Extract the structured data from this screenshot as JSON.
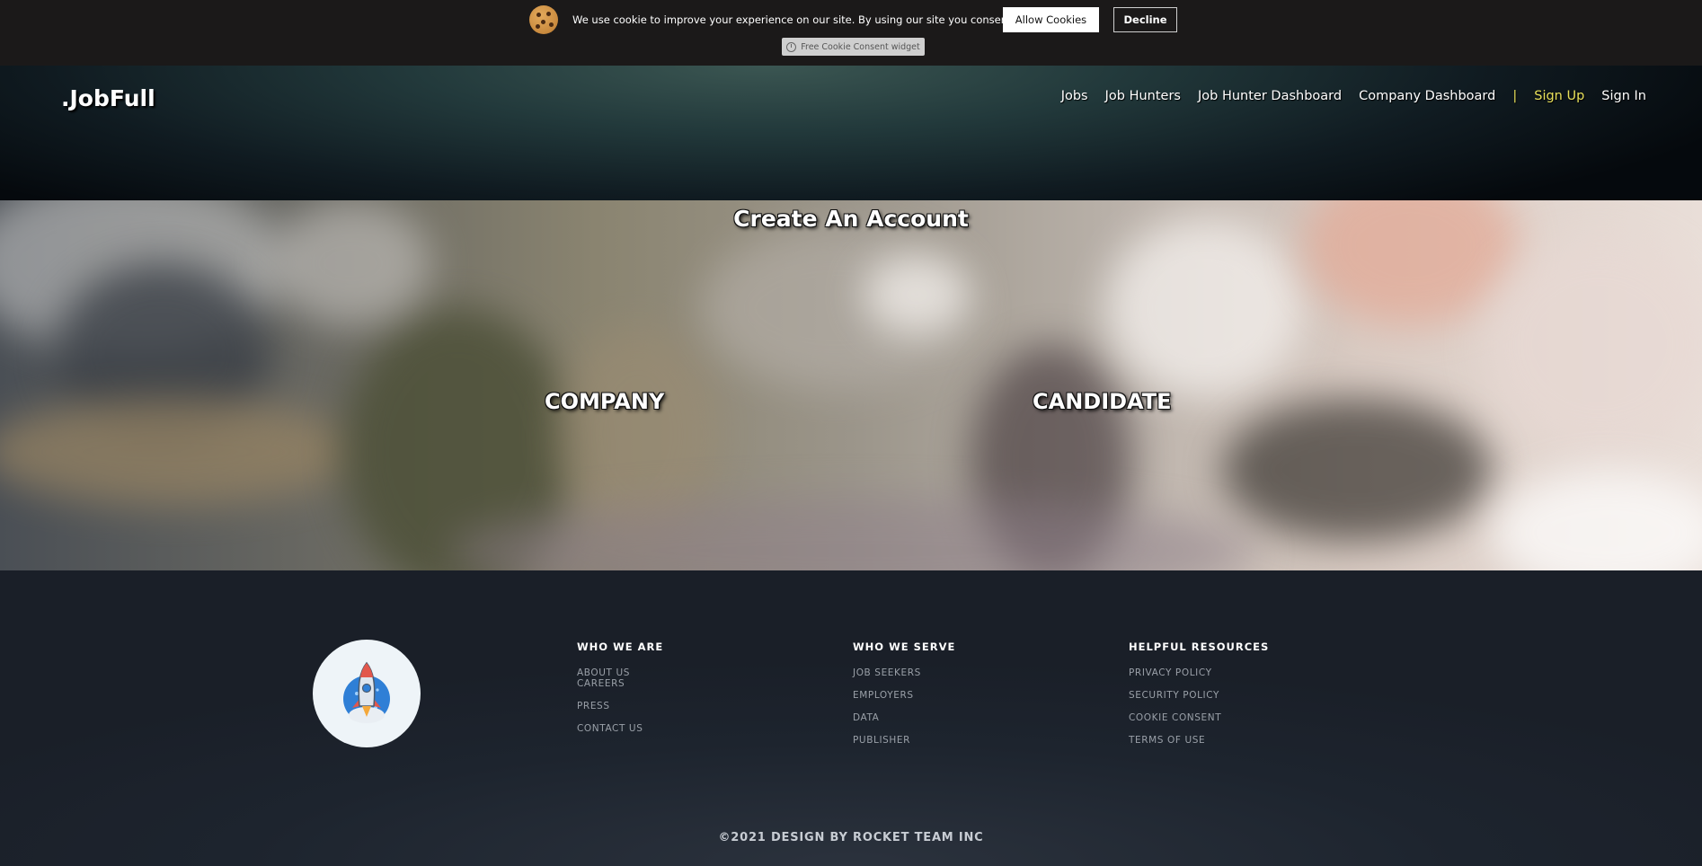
{
  "cookie": {
    "message": "We use cookie to improve your experience on our site. By using our site you consent cookies.",
    "allow_label": "Allow Cookies",
    "decline_label": "Decline",
    "widget_label": "Free Cookie Consent widget"
  },
  "header": {
    "brand": ".JobFull",
    "nav": {
      "jobs": "Jobs",
      "job_hunters": "Job Hunters",
      "job_hunter_dashboard": "Job Hunter Dashboard",
      "company_dashboard": "Company Dashboard",
      "separator": "|",
      "sign_up": "Sign Up",
      "sign_in": "Sign In"
    },
    "accent_color": "#e8e05a"
  },
  "hero": {
    "title": "Create An Account",
    "company_label": "COMPANY",
    "candidate_label": "CANDIDATE"
  },
  "footer": {
    "logo_icon": "rocket-icon",
    "columns": {
      "who_we_are": {
        "heading": "WHO WE ARE",
        "items": [
          "ABOUT US",
          "CAREERS",
          "PRESS",
          "CONTACT US"
        ]
      },
      "who_we_serve": {
        "heading": "WHO WE SERVE",
        "items": [
          "JOB SEEKERS",
          "EMPLOYERS",
          "DATA",
          "PUBLISHER"
        ]
      },
      "helpful_resources": {
        "heading": "HELPFUL RESOURCES",
        "items": [
          "PRIVACY POLICY",
          "SECURITY POLICY",
          "COOKIE CONSENT",
          "TERMS OF USE"
        ]
      }
    },
    "copyright": "©2021 DESIGN BY ROCKET TEAM INC"
  }
}
